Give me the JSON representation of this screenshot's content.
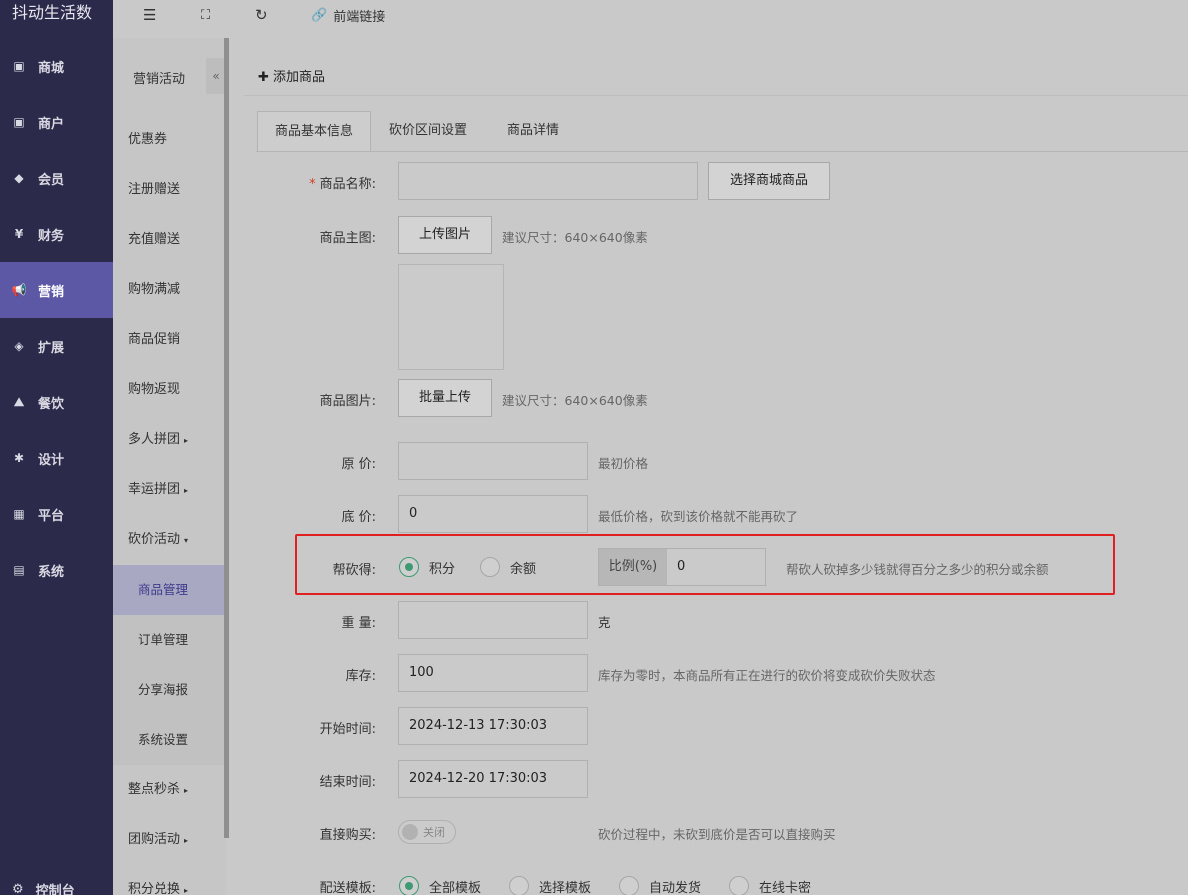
{
  "app": {
    "brand": "抖动生活数"
  },
  "sidebar": {
    "items": [
      {
        "label": "商城",
        "icon": "store-icon"
      },
      {
        "label": "商户",
        "icon": "merchant-icon"
      },
      {
        "label": "会员",
        "icon": "member-icon"
      },
      {
        "label": "财务",
        "icon": "finance-icon"
      },
      {
        "label": "营销",
        "icon": "megaphone-icon",
        "active": true
      },
      {
        "label": "扩展",
        "icon": "cube-icon"
      },
      {
        "label": "餐饮",
        "icon": "dining-icon"
      },
      {
        "label": "设计",
        "icon": "puzzle-icon"
      },
      {
        "label": "平台",
        "icon": "grid-icon"
      },
      {
        "label": "系统",
        "icon": "monitor-icon"
      }
    ],
    "footer": "控制台"
  },
  "topbar": {
    "frontend_link": "前端链接"
  },
  "subnav": {
    "title": "营销活动",
    "collapse": "«",
    "items": [
      "优惠券",
      "注册赠送",
      "充值赠送",
      "购物满减",
      "商品促销",
      "购物返现",
      "多人拼团",
      "幸运拼团",
      "砍价活动"
    ],
    "children": [
      "商品管理",
      "订单管理",
      "分享海报",
      "系统设置"
    ],
    "after": [
      "整点秒杀",
      "团购活动",
      "积分兑换"
    ],
    "arrow": "▸",
    "arrow_down": "▾"
  },
  "page": {
    "title": "添加商品",
    "tabs": [
      "商品基本信息",
      "砍价区间设置",
      "商品详情"
    ]
  },
  "form": {
    "name": {
      "label": "商品名称:",
      "required": "*",
      "value": "",
      "button": "选择商城商品"
    },
    "main_image": {
      "label": "商品主图:",
      "button": "上传图片",
      "hint": "建议尺寸：640×640像素"
    },
    "images": {
      "label": "商品图片:",
      "button": "批量上传",
      "hint": "建议尺寸：640×640像素"
    },
    "original_price": {
      "label": "原 价:",
      "value": "",
      "hint": "最初价格"
    },
    "floor_price": {
      "label": "底 价:",
      "value": "0",
      "hint": "最低价格，砍到该价格就不能再砍了"
    },
    "help_reward": {
      "label": "帮砍得:",
      "options": [
        "积分",
        "余额"
      ],
      "selected": "积分",
      "ratio_label": "比例(%)",
      "ratio_value": "0",
      "hint": "帮砍人砍掉多少钱就得百分之多少的积分或余额"
    },
    "weight": {
      "label": "重 量:",
      "value": "",
      "unit": "克"
    },
    "stock": {
      "label": "库存:",
      "value": "100",
      "hint": "库存为零时，本商品所有正在进行的砍价将变成砍价失败状态"
    },
    "start_time": {
      "label": "开始时间:",
      "value": "2024-12-13 17:30:03"
    },
    "end_time": {
      "label": "结束时间:",
      "value": "2024-12-20 17:30:03"
    },
    "direct_buy": {
      "label": "直接购买:",
      "switch": "关闭",
      "hint": "砍价过程中，未砍到底价是否可以直接购买"
    },
    "delivery": {
      "label": "配送模板:",
      "options": [
        "全部模板",
        "选择模板",
        "自动发货",
        "在线卡密"
      ],
      "selected": "全部模板"
    }
  }
}
